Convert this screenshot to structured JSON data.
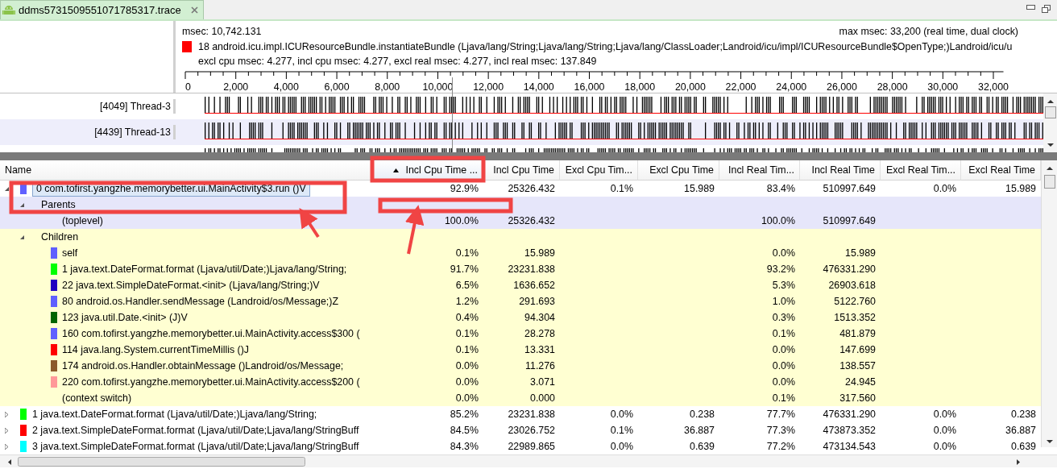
{
  "tab": {
    "title": "ddms5731509551071785317.trace",
    "selected": true
  },
  "timeline": {
    "msec": "msec: 10,742.131",
    "max_msec": "max msec: 33,200 (real time, dual clock)",
    "method": {
      "color": "#ff0000",
      "label": "18 android.icu.impl.ICUResourceBundle.instantiateBundle (Ljava/lang/String;Ljava/lang/String;Ljava/lang/ClassLoader;Landroid/icu/impl/ICUResourceBundle$OpenType;)Landroid/icu/u"
    },
    "stats": "excl cpu msec: 4.277, incl cpu msec: 4.277, excl real msec: 4.277, incl real msec: 137.849",
    "ruler_labels": [
      "0",
      "2,000",
      "4,000",
      "6,000",
      "8,000",
      "10,000",
      "12,000",
      "14,000",
      "16,000",
      "18,000",
      "20,000",
      "22,000",
      "24,000",
      "26,000",
      "28,000",
      "30,000",
      "32,000"
    ],
    "threads": [
      {
        "label": "[4049] Thread-3",
        "selected": false
      },
      {
        "label": "[4439] Thread-13",
        "selected": true
      },
      {
        "selected": false
      }
    ]
  },
  "table": {
    "name_column": {
      "label": "Name"
    },
    "columns": [
      {
        "label": "Incl Cpu Time ...",
        "sorted": true
      },
      {
        "label": "Incl Cpu Time"
      },
      {
        "label": "Excl Cpu Tim..."
      },
      {
        "label": "Excl Cpu Time"
      },
      {
        "label": "Incl Real Tim..."
      },
      {
        "label": "Incl Real Time"
      },
      {
        "label": "Excl Real Tim..."
      },
      {
        "label": "Excl Real Time"
      }
    ],
    "rows": [
      {
        "name": "0 com.tofirst.yangzhe.memorybetter.ui.MainActivity$3.run ()V",
        "color": "#6060ff",
        "selected": true,
        "expanded": true,
        "cells": [
          "92.9%",
          "25326.432",
          "0.1%",
          "15.989",
          "83.4%",
          "510997.649",
          "0.0%",
          "15.989"
        ],
        "children": [
          {
            "kind": "parents",
            "name": "Parents",
            "expanded": true,
            "children": [
              {
                "name": "(toplevel)",
                "cells": [
                  "100.0%",
                  "25326.432",
                  null,
                  null,
                  "100.0%",
                  "510997.649",
                  null,
                  null
                ]
              }
            ]
          },
          {
            "kind": "children",
            "name": "Children",
            "expanded": true,
            "children": [
              {
                "name": "self",
                "color": "#6060ff",
                "cells": [
                  "0.1%",
                  "15.989",
                  null,
                  null,
                  "0.0%",
                  "15.989",
                  null,
                  null
                ]
              },
              {
                "name": "1 java.text.DateFormat.format (Ljava/util/Date;)Ljava/lang/String;",
                "color": "#00ff00",
                "cells": [
                  "91.7%",
                  "23231.838",
                  null,
                  null,
                  "93.2%",
                  "476331.290",
                  null,
                  null
                ]
              },
              {
                "name": "22 java.text.SimpleDateFormat.<init> (Ljava/lang/String;)V",
                "color": "#2000c0",
                "cells": [
                  "6.5%",
                  "1636.652",
                  null,
                  null,
                  "5.3%",
                  "26903.618",
                  null,
                  null
                ]
              },
              {
                "name": "80 android.os.Handler.sendMessage (Landroid/os/Message;)Z",
                "color": "#6060ff",
                "cells": [
                  "1.2%",
                  "291.693",
                  null,
                  null,
                  "1.0%",
                  "5122.760",
                  null,
                  null
                ]
              },
              {
                "name": "123 java.util.Date.<init> (J)V",
                "color": "#006400",
                "cells": [
                  "0.4%",
                  "94.304",
                  null,
                  null,
                  "0.3%",
                  "1513.352",
                  null,
                  null
                ]
              },
              {
                "name": "160 com.tofirst.yangzhe.memorybetter.ui.MainActivity.access$300 (",
                "color": "#6060ff",
                "cells": [
                  "0.1%",
                  "28.278",
                  null,
                  null,
                  "0.1%",
                  "481.879",
                  null,
                  null
                ]
              },
              {
                "name": "114 java.lang.System.currentTimeMillis ()J",
                "color": "#ff0000",
                "cells": [
                  "0.1%",
                  "13.331",
                  null,
                  null,
                  "0.0%",
                  "147.699",
                  null,
                  null
                ]
              },
              {
                "name": "174 android.os.Handler.obtainMessage ()Landroid/os/Message;",
                "color": "#8b5a2b",
                "cells": [
                  "0.0%",
                  "11.276",
                  null,
                  null,
                  "0.0%",
                  "138.557",
                  null,
                  null
                ]
              },
              {
                "name": "220 com.tofirst.yangzhe.memorybetter.ui.MainActivity.access$200 (",
                "color": "#ff9999",
                "cells": [
                  "0.0%",
                  "3.071",
                  null,
                  null,
                  "0.0%",
                  "24.945",
                  null,
                  null
                ]
              },
              {
                "name": "(context switch)",
                "cells": [
                  "0.0%",
                  "0.000",
                  null,
                  null,
                  "0.1%",
                  "317.560",
                  null,
                  null
                ]
              }
            ]
          }
        ]
      },
      {
        "name": "1 java.text.DateFormat.format (Ljava/util/Date;)Ljava/lang/String;",
        "color": "#00ff00",
        "selected": false,
        "expanded": false,
        "cells": [
          "85.2%",
          "23231.838",
          "0.0%",
          "0.238",
          "77.7%",
          "476331.290",
          "0.0%",
          "0.238"
        ]
      },
      {
        "name": "2 java.text.SimpleDateFormat.format (Ljava/util/Date;Ljava/lang/StringBuff",
        "color": "#ff0000",
        "selected": false,
        "expanded": false,
        "cells": [
          "84.5%",
          "23026.752",
          "0.1%",
          "36.887",
          "77.3%",
          "473873.352",
          "0.0%",
          "36.887"
        ]
      },
      {
        "name": "3 java.text.SimpleDateFormat.format (Ljava/util/Date;Ljava/lang/StringBuff",
        "color": "#00ffff",
        "selected": false,
        "expanded": false,
        "cells": [
          "84.3%",
          "22989.865",
          "0.0%",
          "0.639",
          "77.2%",
          "473134.543",
          "0.0%",
          "0.639"
        ]
      }
    ]
  }
}
